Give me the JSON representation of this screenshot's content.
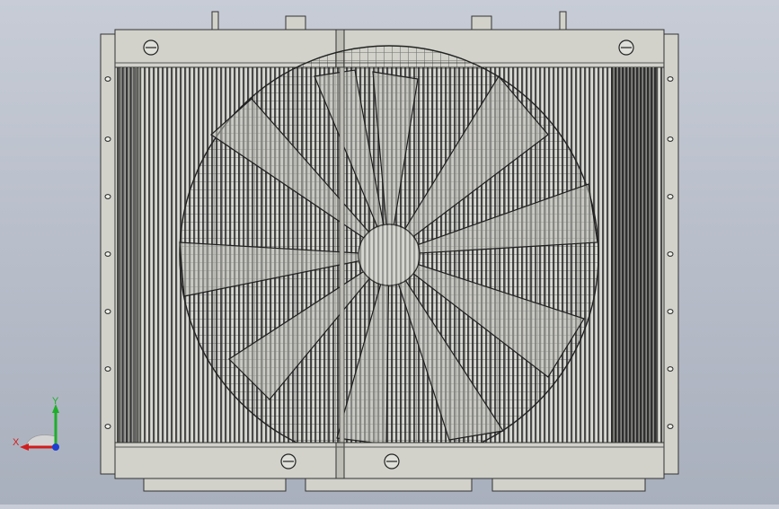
{
  "viewport": {
    "background_top": "#c7ccd6",
    "background_bottom": "#a9b0bd"
  },
  "model": {
    "frame_color": "#d2d2cb",
    "fin_color": "#4a4a4a",
    "line_color": "#2b2b2b"
  },
  "triad": {
    "x_label": "X",
    "y_label": "Y",
    "x_color": "#d11d1d",
    "y_color": "#1fae2a",
    "z_color": "#1f3fd1"
  }
}
